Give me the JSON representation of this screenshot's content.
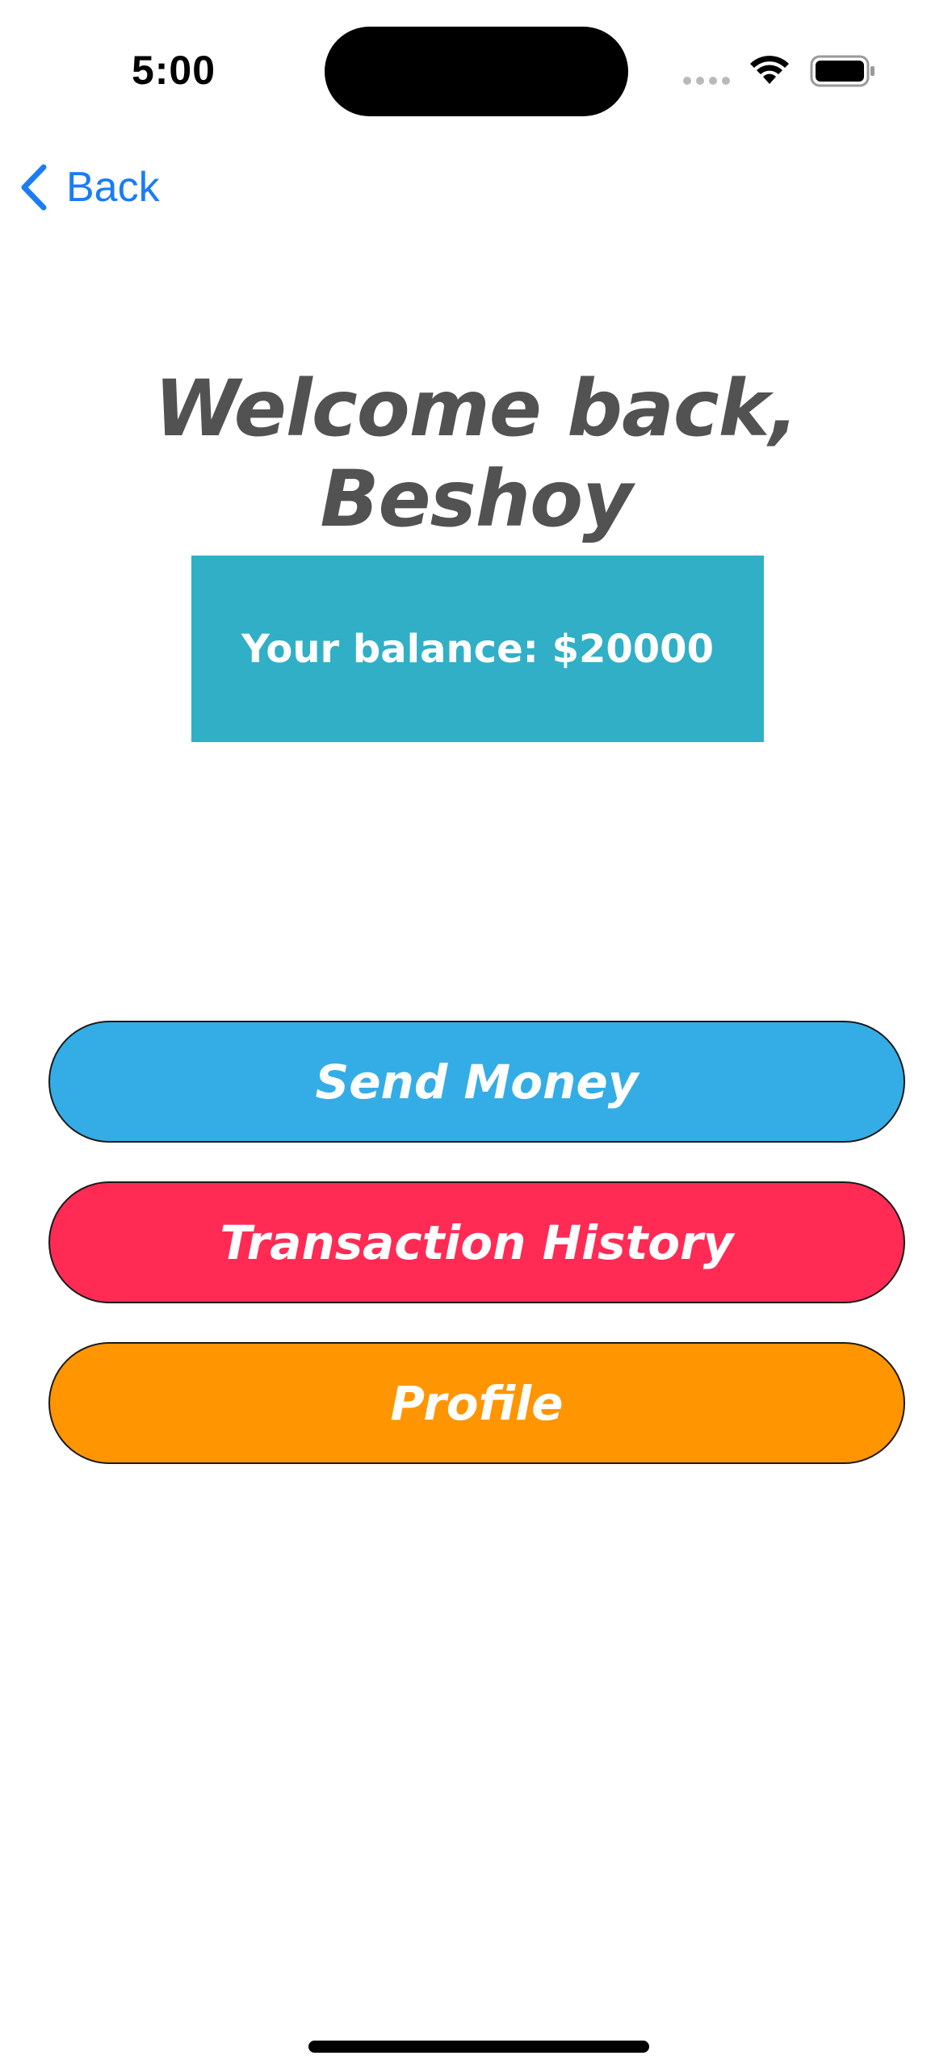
{
  "status_bar": {
    "time": "5:00"
  },
  "nav": {
    "back_label": "Back",
    "back_icon": "chevron-left-icon"
  },
  "header": {
    "title": "Welcome back, Beshoy"
  },
  "balance": {
    "text": "Your balance: $20000",
    "color": "#31afc7"
  },
  "actions": [
    {
      "label": "Send Money",
      "color": "#34ade6"
    },
    {
      "label": "Transaction History",
      "color": "#ff2b55"
    },
    {
      "label": "Profile",
      "color": "#ff9500"
    }
  ],
  "colors": {
    "accent": "#1b7cf5",
    "title": "#525252"
  }
}
